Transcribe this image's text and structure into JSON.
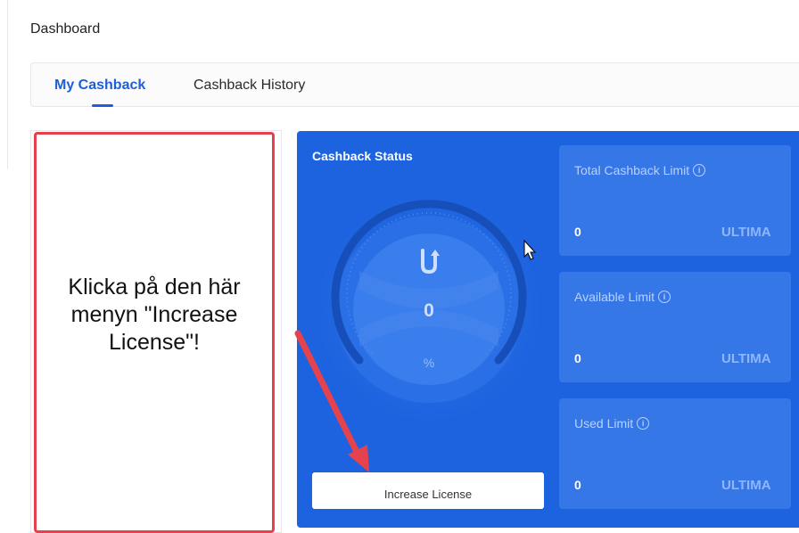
{
  "breadcrumb": "Dashboard",
  "tabs": [
    {
      "label": "My Cashback",
      "active": true
    },
    {
      "label": "Cashback History",
      "active": false
    }
  ],
  "annotation": {
    "text": "Klicka på den här menyn \"Increase License\"!",
    "border_color": "#e5424d",
    "arrow_color": "#e5424d"
  },
  "cashback_status": {
    "title": "Cashback Status",
    "gauge_value": "0",
    "gauge_unit": "%",
    "gauge_fraction": 0,
    "button_label": "Increase License"
  },
  "limits": [
    {
      "label": "Total Cashback Limit",
      "value": "0",
      "unit": "ULTIMA",
      "info_icon": "info-icon"
    },
    {
      "label": "Available Limit",
      "value": "0",
      "unit": "ULTIMA",
      "info_icon": "info-icon"
    },
    {
      "label": "Used Limit",
      "value": "0",
      "unit": "ULTIMA",
      "info_icon": "info-icon"
    }
  ],
  "colors": {
    "accent": "#1d5fd6",
    "panel_bg": "#1d63df",
    "card_bg": "#3577e6"
  }
}
